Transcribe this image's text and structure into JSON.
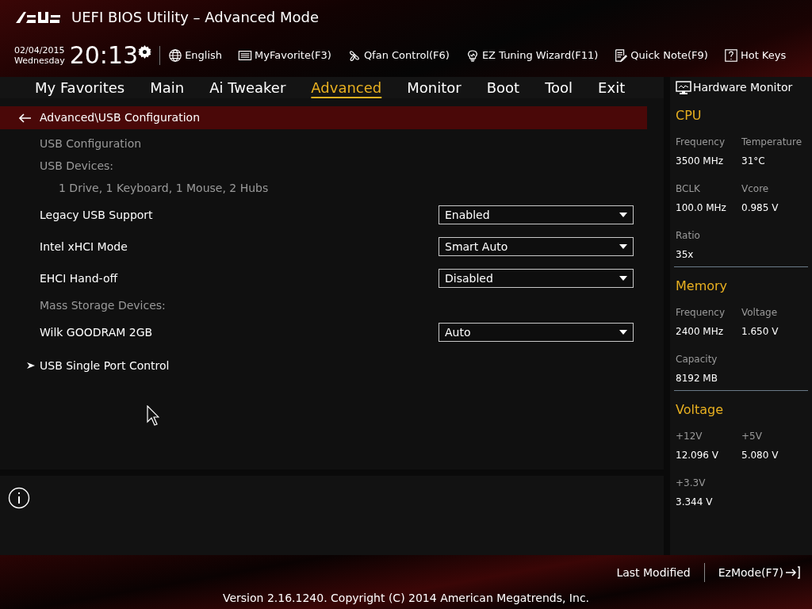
{
  "window": {
    "title": "UEFI BIOS Utility – Advanced Mode"
  },
  "toolbar": {
    "date": "02/04/2015",
    "weekday": "Wednesday",
    "time": "20:13",
    "items": [
      {
        "kind": "globe",
        "label": "English"
      },
      {
        "kind": "favorite",
        "label": "MyFavorite(F3)"
      },
      {
        "kind": "fan",
        "label": "Qfan Control(F6)"
      },
      {
        "kind": "bulb",
        "label": "EZ Tuning Wizard(F11)"
      },
      {
        "kind": "note",
        "label": "Quick Note(F9)"
      },
      {
        "kind": "help",
        "label": "Hot Keys"
      }
    ]
  },
  "tabs": [
    {
      "label": "My Favorites",
      "selected": false
    },
    {
      "label": "Main",
      "selected": false
    },
    {
      "label": "Ai Tweaker",
      "selected": false
    },
    {
      "label": "Advanced",
      "selected": true
    },
    {
      "label": "Monitor",
      "selected": false
    },
    {
      "label": "Boot",
      "selected": false
    },
    {
      "label": "Tool",
      "selected": false
    },
    {
      "label": "Exit",
      "selected": false
    }
  ],
  "breadcrumb": "Advanced\\USB Configuration",
  "settings": [
    {
      "kind": "heading",
      "label": "USB Configuration"
    },
    {
      "kind": "heading",
      "label": "USB Devices:"
    },
    {
      "kind": "info",
      "label": "1 Drive, 1 Keyboard, 1 Mouse, 2 Hubs"
    },
    {
      "kind": "option",
      "label": "Legacy USB Support",
      "value": "Enabled"
    },
    {
      "kind": "option",
      "label": "Intel xHCI Mode",
      "value": "Smart Auto"
    },
    {
      "kind": "option",
      "label": "EHCI Hand-off",
      "value": "Disabled"
    },
    {
      "kind": "heading",
      "label": "Mass Storage Devices:"
    },
    {
      "kind": "option",
      "label": "Wilk GOODRAM 2GB",
      "value": "Auto"
    },
    {
      "kind": "submenu",
      "label": "USB Single Port Control"
    }
  ],
  "hardware_monitor": {
    "title": "Hardware Monitor",
    "sections": [
      {
        "title": "CPU",
        "fields": [
          {
            "label": "Frequency",
            "value": "3500 MHz"
          },
          {
            "label": "Temperature",
            "value": "31°C"
          },
          {
            "label": "BCLK",
            "value": "100.0 MHz"
          },
          {
            "label": "Vcore",
            "value": "0.985 V"
          },
          {
            "label": "Ratio",
            "value": "35x"
          }
        ]
      },
      {
        "title": "Memory",
        "fields": [
          {
            "label": "Frequency",
            "value": "2400 MHz"
          },
          {
            "label": "Voltage",
            "value": "1.650 V"
          },
          {
            "label": "Capacity",
            "value": "8192 MB"
          }
        ]
      },
      {
        "title": "Voltage",
        "fields": [
          {
            "label": "+12V",
            "value": "12.096 V"
          },
          {
            "label": "+5V",
            "value": "5.080 V"
          },
          {
            "label": "+3.3V",
            "value": "3.344 V"
          }
        ]
      }
    ]
  },
  "footer": {
    "last_modified": "Last Modified",
    "ez_mode": "EzMode(F7)",
    "copyright": "Version 2.16.1240. Copyright (C) 2014 American Megatrends, Inc."
  }
}
